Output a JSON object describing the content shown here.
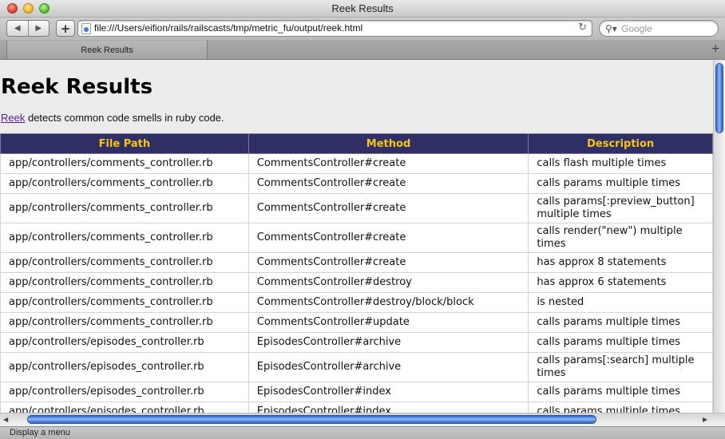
{
  "window": {
    "title": "Reek Results"
  },
  "toolbar": {
    "back_icon": "back-arrow-icon",
    "forward_icon": "forward-arrow-icon",
    "add_label": "+",
    "url": "file:///Users/eifion/rails/railscasts/tmp/metric_fu/output/reek.html",
    "search_placeholder": "Google"
  },
  "tabs": [
    {
      "label": "Reek Results",
      "active": true
    }
  ],
  "page": {
    "title": "Reek Results",
    "intro_link": "Reek",
    "intro_text": " detects common code smells in ruby code.",
    "link_color": "#551a8b"
  },
  "table": {
    "header_bg": "#2f2f66",
    "header_color": "#f5c518",
    "columns": [
      "File Path",
      "Method",
      "Description"
    ],
    "rows": [
      [
        "app/controllers/comments_controller.rb",
        "CommentsController#create",
        "calls flash multiple times"
      ],
      [
        "app/controllers/comments_controller.rb",
        "CommentsController#create",
        "calls params multiple times"
      ],
      [
        "app/controllers/comments_controller.rb",
        "CommentsController#create",
        "calls params[:preview_button] multiple times"
      ],
      [
        "app/controllers/comments_controller.rb",
        "CommentsController#create",
        "calls render(\"new\") multiple times"
      ],
      [
        "app/controllers/comments_controller.rb",
        "CommentsController#create",
        "has approx 8 statements"
      ],
      [
        "app/controllers/comments_controller.rb",
        "CommentsController#destroy",
        "has approx 6 statements"
      ],
      [
        "app/controllers/comments_controller.rb",
        "CommentsController#destroy/block/block",
        "is nested"
      ],
      [
        "app/controllers/comments_controller.rb",
        "CommentsController#update",
        "calls params multiple times"
      ],
      [
        "app/controllers/episodes_controller.rb",
        "EpisodesController#archive",
        "calls params multiple times"
      ],
      [
        "app/controllers/episodes_controller.rb",
        "EpisodesController#archive",
        "calls params[:search] multiple times"
      ],
      [
        "app/controllers/episodes_controller.rb",
        "EpisodesController#index",
        "calls params multiple times"
      ],
      [
        "app/controllers/episodes_controller.rb",
        "EpisodesController#index",
        "calls params multiple times"
      ]
    ]
  },
  "statusbar": {
    "text": "Display a menu"
  }
}
